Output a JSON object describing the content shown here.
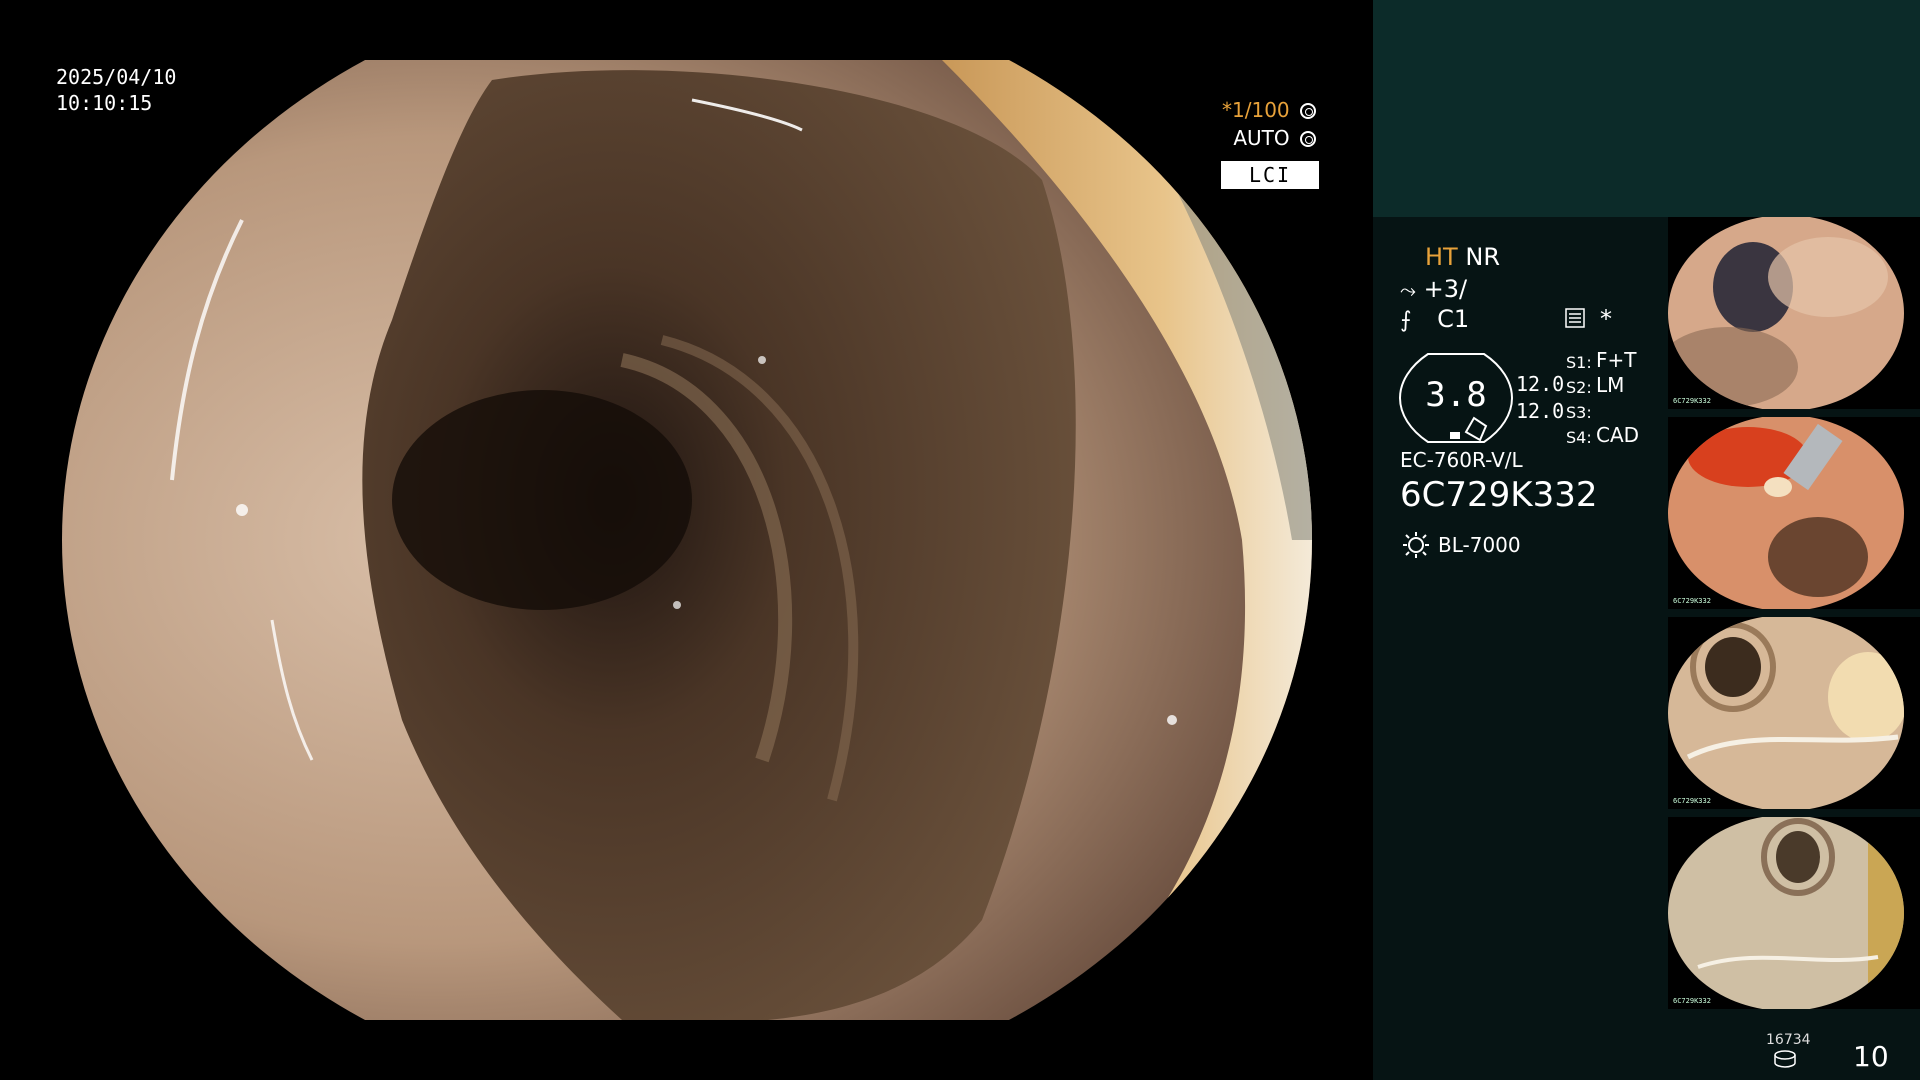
{
  "overlay": {
    "date": "2025/04/10",
    "time": "10:10:15",
    "shutter": "*1/100",
    "shutter_icon": "aperture-icon",
    "iris_mode": "AUTO",
    "iris_icon": "iris-icon",
    "mode_label": "LCI"
  },
  "panel": {
    "ht": "HT",
    "nr": "NR",
    "enhancement": "+3/",
    "enhancement_icon": "enhancement-icon",
    "color": "C1",
    "color_icon": "color-icon",
    "menu_icon": "menu-icon",
    "star": "*",
    "gauge_value": "3.8",
    "value_1": "12.0",
    "value_2": "12.0",
    "switches": [
      {
        "label": "S1:",
        "value": "F+T"
      },
      {
        "label": "S2:",
        "value": "LM"
      },
      {
        "label": "S3:",
        "value": ""
      },
      {
        "label": "S4:",
        "value": "CAD"
      }
    ],
    "scope_model": "EC-760R-V/L",
    "serial": "6C729K332",
    "light_source": "BL-7000",
    "light_icon": "light-source-icon",
    "counter": "16734",
    "storage_icon": "storage-icon",
    "image_count": "10"
  },
  "thumbnails": [
    {
      "label": "6C729K332"
    },
    {
      "label": "6C729K332"
    },
    {
      "label": "6C729K332"
    },
    {
      "label": "6C729K332"
    }
  ],
  "colors": {
    "accent_orange": "#e8a23a",
    "panel_dark": "#061414",
    "panel_teal": "#0c2b29"
  }
}
